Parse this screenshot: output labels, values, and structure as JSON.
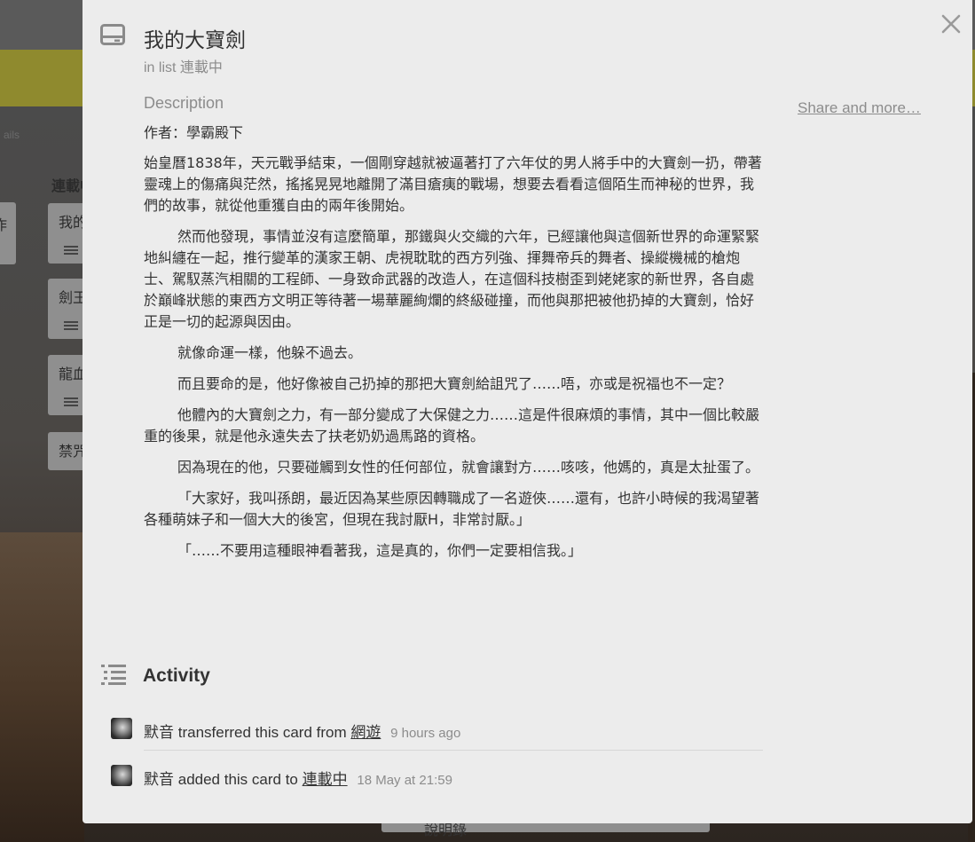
{
  "background": {
    "faint_text": "ails",
    "list_title": "連載中",
    "left_card": "作",
    "cards": [
      {
        "label": "我的"
      },
      {
        "label": "劍王"
      },
      {
        "label": "龍血"
      },
      {
        "label": "禁咒"
      }
    ],
    "bottom_button": "說明錄"
  },
  "card": {
    "title": "我的大寶劍",
    "in_list_prefix": "in list",
    "list_name": "連載中",
    "share_label": "Share and more…",
    "description_label": "Description",
    "description": [
      "作者：學霸殿下",
      "始皇曆1838年，天元戰爭結束，一個剛穿越就被逼著打了六年仗的男人將手中的大寶劍一扔，帶著靈魂上的傷痛與茫然，搖搖晃晃地離開了滿目瘡痍的戰場，想要去看看這個陌生而神秘的世界，我們的故事，就從他重獲自由的兩年後開始。",
      "然而他發現，事情並沒有這麼簡單，那鐵與火交織的六年，已經讓他與這個新世界的命運緊緊地糾纏在一起，推行變革的漢家王朝、虎視耽耽的西方列強、揮舞帝兵的舞者、操縱機械的槍炮士、駕馭蒸汽相關的工程師、一身致命武器的改造人，在這個科技樹歪到姥姥家的新世界，各自處於巔峰狀態的東西方文明正等待著一場華麗絢爛的終級碰撞，而他與那把被他扔掉的大寶劍，恰好正是一切的起源與因由。",
      "就像命運一樣，他躲不過去。",
      "而且要命的是，他好像被自己扔掉的那把大寶劍給詛咒了……唔，亦或是祝福也不一定？",
      "他體內的大寶劍之力，有一部分變成了大保健之力……這是件很麻煩的事情，其中一個比較嚴重的後果，就是他永遠失去了扶老奶奶過馬路的資格。",
      "因為現在的他，只要碰觸到女性的任何部位，就會讓對方……咳咳，他媽的，真是太扯蛋了。",
      "「大家好，我叫孫朗，最近因為某些原因轉職成了一名遊俠……還有，也許小時候的我渴望著各種萌妹子和一個大大的後宮，但現在我討厭H，非常討厭。」",
      "「……不要用這種眼神看著我，這是真的，你們一定要相信我。」"
    ],
    "activity_title": "Activity",
    "activity": [
      {
        "user": "默音",
        "action": "transferred this card from",
        "target": "網遊",
        "time": "9 hours ago"
      },
      {
        "user": "默音",
        "action": "added this card to",
        "target": "連載中",
        "time": "18 May at 21:59"
      }
    ],
    "icons": {
      "card": "card-icon",
      "close": "close-icon",
      "activity": "activity-list-icon"
    },
    "colors": {
      "modal_bg": "#ececec",
      "muted_text": "#8c8c8c",
      "body_text": "#333333"
    }
  }
}
